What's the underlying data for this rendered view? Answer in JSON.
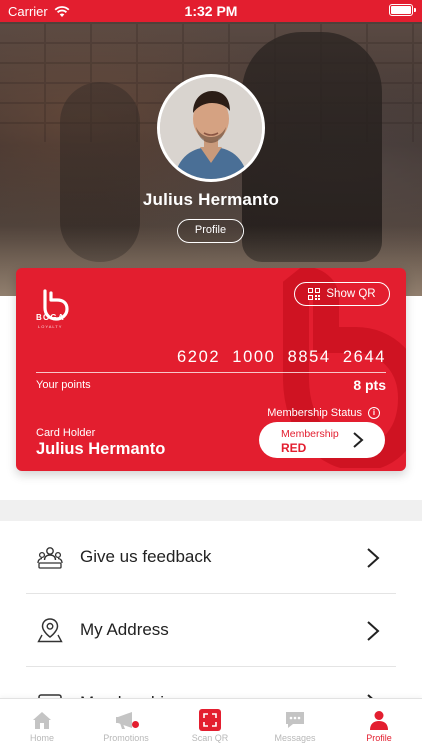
{
  "status_bar": {
    "carrier": "Carrier",
    "time": "1:32 PM"
  },
  "profile": {
    "name": "Julius Hermanto",
    "profile_button": "Profile"
  },
  "card": {
    "brand": "BOGA",
    "brand_sub": "LOYALTY",
    "show_qr": "Show QR",
    "number": "6202 1000 8854 2644",
    "points_label": "Your points",
    "points_value": "8 pts",
    "membership_status_label": "Membership Status",
    "card_holder_label": "Card Holder",
    "card_holder_name": "Julius Hermanto",
    "membership_label": "Membership",
    "membership_value": "RED"
  },
  "menu": [
    {
      "label": "Give us feedback",
      "icon": "feedback-people-icon"
    },
    {
      "label": "My Address",
      "icon": "map-pin-icon"
    },
    {
      "label": "Membership",
      "icon": "membership-card-icon"
    }
  ],
  "tabs": [
    {
      "label": "Home",
      "icon": "home-icon"
    },
    {
      "label": "Promotions",
      "icon": "promotions-icon"
    },
    {
      "label": "Scan QR",
      "icon": "scan-qr-icon"
    },
    {
      "label": "Messages",
      "icon": "messages-icon"
    },
    {
      "label": "Profile",
      "icon": "profile-icon"
    }
  ],
  "colors": {
    "brand": "#e31e2f",
    "inactive": "#b8b8b8",
    "text": "#222222"
  }
}
